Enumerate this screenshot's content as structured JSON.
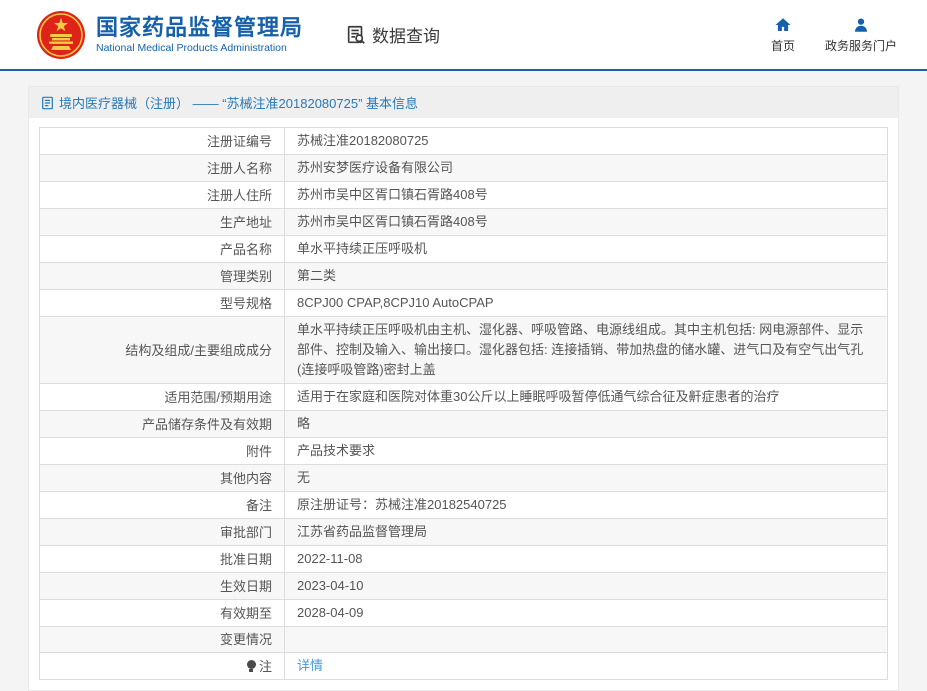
{
  "header": {
    "logo_title": "国家药品监督管理局",
    "logo_subtitle": "National Medical Products Administration",
    "section_title": "数据查询",
    "nav": {
      "home_label": "首页",
      "portal_label": "政务服务门户"
    },
    "colors": {
      "brand_blue": "#1660ab",
      "emblem_red": "#de2318",
      "emblem_gold": "#f7c948"
    }
  },
  "breadcrumb": {
    "text": "境内医疗器械（注册） —— “苏械注准20182080725” 基本信息"
  },
  "table": {
    "rows": [
      {
        "label": "注册证编号",
        "value": "苏械注准20182080725"
      },
      {
        "label": "注册人名称",
        "value": "苏州安梦医疗设备有限公司"
      },
      {
        "label": "注册人住所",
        "value": "苏州市吴中区胥口镇石胥路408号"
      },
      {
        "label": "生产地址",
        "value": "苏州市吴中区胥口镇石胥路408号"
      },
      {
        "label": "产品名称",
        "value": "单水平持续正压呼吸机"
      },
      {
        "label": "管理类别",
        "value": "第二类"
      },
      {
        "label": "型号规格",
        "value": "8CPJ00 CPAP,8CPJ10 AutoCPAP"
      },
      {
        "label": "结构及组成/主要组成成分",
        "value": "单水平持续正压呼吸机由主机、湿化器、呼吸管路、电源线组成。其中主机包括: 网电源部件、显示部件、控制及输入、输出接口。湿化器包括: 连接插销、带加热盘的储水罐、进气口及有空气出气孔(连接呼吸管路)密封上盖"
      },
      {
        "label": "适用范围/预期用途",
        "value": "适用于在家庭和医院对体重30公斤以上睡眠呼吸暂停低通气综合征及鼾症患者的治疗"
      },
      {
        "label": "产品储存条件及有效期",
        "value": "略"
      },
      {
        "label": "附件",
        "value": "产品技术要求"
      },
      {
        "label": "其他内容",
        "value": "无"
      },
      {
        "label": "备注",
        "value": "原注册证号：苏械注准20182540725"
      },
      {
        "label": "审批部门",
        "value": "江苏省药品监督管理局"
      },
      {
        "label": "批准日期",
        "value": "2022-11-08"
      },
      {
        "label": "生效日期",
        "value": "2023-04-10"
      },
      {
        "label": "有效期至",
        "value": "2028-04-09"
      },
      {
        "label": "变更情况",
        "value": ""
      },
      {
        "label": "注",
        "value": "详情",
        "link": true,
        "icon": "bulb-icon"
      }
    ]
  }
}
